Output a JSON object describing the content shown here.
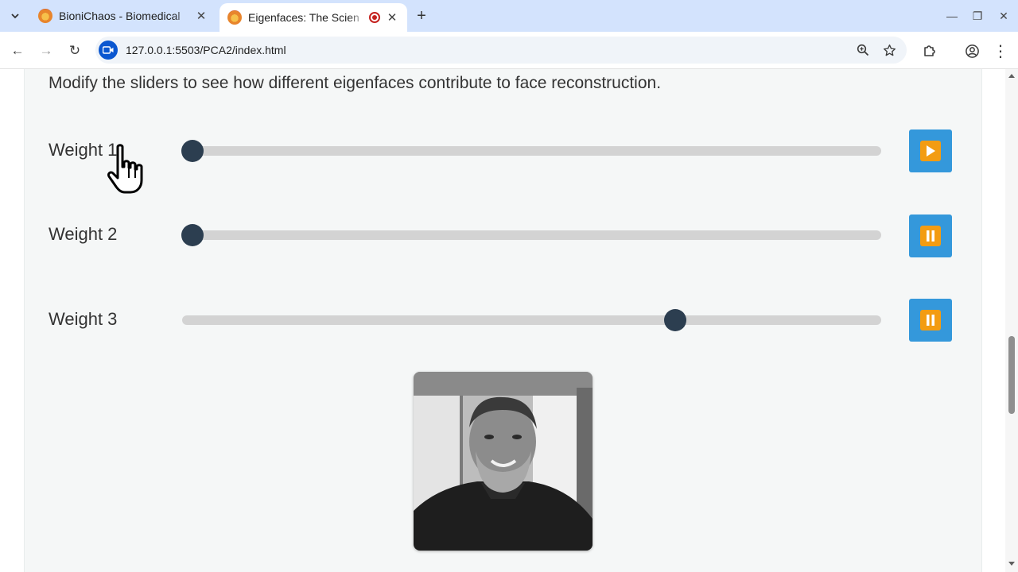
{
  "browser": {
    "tabs": [
      {
        "title": "BioniChaos - Biomedical",
        "active": false
      },
      {
        "title": "Eigenfaces: The Scien",
        "active": true
      }
    ],
    "tab_close_glyph": "✕",
    "new_tab_glyph": "+",
    "window_controls": {
      "minimize": "—",
      "restore": "❐",
      "close": "✕"
    },
    "url": "127.0.0.1:5503/PCA2/index.html",
    "nav_glyphs": {
      "back": "←",
      "forward": "→",
      "reload": "↻",
      "menu": "⋮"
    }
  },
  "page": {
    "instructions": "Modify the sliders to see how different eigenfaces contribute to face reconstruction.",
    "weights": [
      {
        "label": "Weight 1",
        "value": 0.015,
        "button_state": "play"
      },
      {
        "label": "Weight 2",
        "value": 0.015,
        "button_state": "pause"
      },
      {
        "label": "Weight 3",
        "value": 0.705,
        "button_state": "pause"
      }
    ],
    "face_image": "reconstructed-face"
  },
  "colors": {
    "slider_track": "#d3d3d3",
    "slider_thumb": "#2c3e50",
    "button_bg": "#3498db",
    "button_glyph": "#f39c12"
  }
}
